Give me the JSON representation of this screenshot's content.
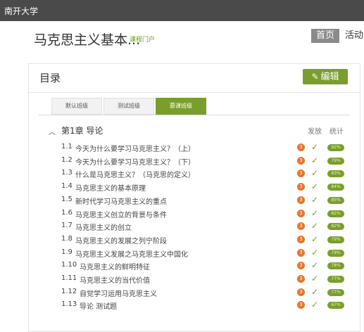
{
  "topbar": {
    "brand": "南开大学"
  },
  "header": {
    "course_title": "马克思主义基本...",
    "portal_link": "课程门户",
    "nav_home": "首页",
    "nav_activity": "活动"
  },
  "panel": {
    "title": "目录",
    "edit_label": "编辑",
    "tabs": [
      {
        "label": "默认班级",
        "active": false
      },
      {
        "label": "测试班级",
        "active": false
      },
      {
        "label": "慕课班级",
        "active": true
      }
    ]
  },
  "chapter": {
    "title": "第1章 导论",
    "col_publish": "发放",
    "col_stats": "统计",
    "lessons": [
      {
        "num": "1.1",
        "name": "今天为什么要学习马克思主义？（上）",
        "badge": "3",
        "percent": "92%"
      },
      {
        "num": "1.2",
        "name": "今天为什么要学习马克思主义？（下）",
        "badge": "3",
        "percent": "79%"
      },
      {
        "num": "1.3",
        "name": "什么是马克思主义？（马克思的定义）",
        "badge": "3",
        "percent": "83%"
      },
      {
        "num": "1.4",
        "name": "马克思主义的基本原理",
        "badge": "3",
        "percent": "84%"
      },
      {
        "num": "1.5",
        "name": "新时代学习马克思主义的重点",
        "badge": "3",
        "percent": "85%"
      },
      {
        "num": "1.6",
        "name": "马克思主义创立的背景与条件",
        "badge": "3",
        "percent": "82%"
      },
      {
        "num": "1.7",
        "name": "马克思主义的创立",
        "badge": "3",
        "percent": "82%"
      },
      {
        "num": "1.8",
        "name": "马克思主义的发展之列宁阶段",
        "badge": "3",
        "percent": "79%"
      },
      {
        "num": "1.9",
        "name": "马克思主义发展之马克思主义中国化",
        "badge": "3",
        "percent": "79%"
      },
      {
        "num": "1.10",
        "name": "马克思主义的鲜明特征",
        "badge": "3",
        "percent": "78%"
      },
      {
        "num": "1.11",
        "name": "马克思主义的当代价值",
        "badge": "3",
        "percent": "77%"
      },
      {
        "num": "1.12",
        "name": "自觉学习运用马克思主义",
        "badge": "3",
        "percent": "77%"
      },
      {
        "num": "1.13",
        "name": "导论 测试题",
        "badge": "3",
        "percent": "67%"
      }
    ]
  }
}
